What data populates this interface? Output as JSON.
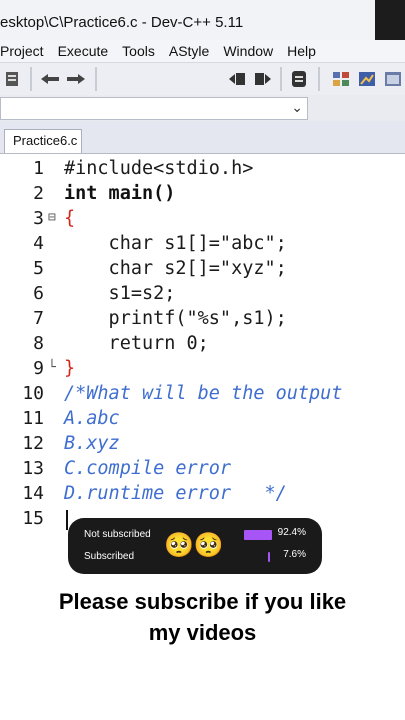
{
  "window": {
    "title": "esktop\\C\\Practice6.c - Dev-C++ 5.11"
  },
  "menu": [
    "Project",
    "Execute",
    "Tools",
    "AStyle",
    "Window",
    "Help"
  ],
  "tab": {
    "label": "Practice6.c"
  },
  "editor": {
    "line_numbers": [
      "1",
      "2",
      "3",
      "4",
      "5",
      "6",
      "7",
      "8",
      "9",
      "10",
      "11",
      "12",
      "13",
      "14",
      "15"
    ],
    "lines": [
      "#include<stdio.h>",
      "int main()",
      "{",
      "    char s1[]=\"abc\";",
      "    char s2[]=\"xyz\";",
      "    s1=s2;",
      "    printf(\"%s\",s1);",
      "    return 0;",
      "}",
      "/*What will be the output",
      "A.abc",
      "B.xyz",
      "C.compile error",
      "D.runtime error   */",
      ""
    ]
  },
  "poll": {
    "options": [
      {
        "label": "Not subscribed",
        "percent": "92.4%",
        "value": 0.924
      },
      {
        "label": "Subscribed",
        "percent": "7.6%",
        "value": 0.076
      }
    ],
    "emoji": "🥺🥺"
  },
  "caption": {
    "line1": "Please subscribe if you like",
    "line2": "my videos"
  },
  "colors": {
    "brace": "#d0291b",
    "string": "#1f3ad8",
    "comment": "#3f6ed0",
    "poll_bar": "#a855f7"
  }
}
